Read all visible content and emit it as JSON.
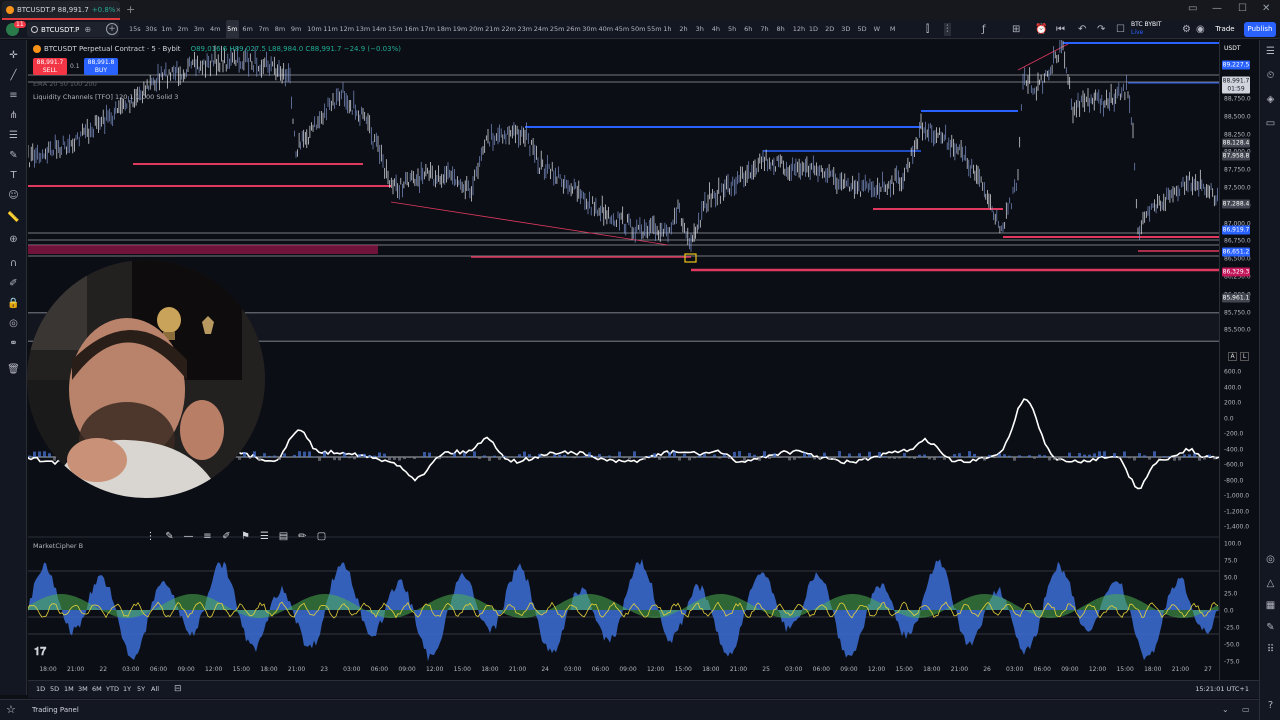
{
  "browser": {
    "tab_title": "BTCUSDT.P",
    "tab_price": "88,991.7",
    "tab_change": "+0.8%"
  },
  "toolbar": {
    "notification_count": "11",
    "symbol": "BTCUSDT.P",
    "intervals": [
      "15s",
      "30s",
      "1m",
      "2m",
      "3m",
      "4m",
      "5m",
      "6m",
      "7m",
      "8m",
      "9m",
      "10m",
      "11m",
      "12m",
      "13m",
      "14m",
      "15m",
      "16m",
      "17m",
      "18m",
      "19m",
      "20m",
      "21m",
      "22m",
      "23m",
      "24m",
      "25m",
      "26m",
      "30m",
      "40m",
      "45m",
      "50m",
      "55m",
      "1h",
      "2h",
      "3h",
      "4h",
      "5h",
      "6h",
      "7h",
      "8h",
      "12h",
      "1D",
      "2D",
      "3D",
      "5D",
      "W",
      "M"
    ],
    "active_interval": "5m",
    "broker": "BTC BYBIT",
    "broker_sub": "Live",
    "trade_label": "Trade",
    "publish_label": "Publish"
  },
  "legend": {
    "title": "BTCUSDT Perpetual Contract · 5 · Bybit",
    "ohlc": "O89,016.6 H89,027.5 L88,984.0 C88,991.7 −24.9 (−0.03%)",
    "sell_price": "88,991.7",
    "sell_label": "SELL",
    "spread": "0.1",
    "buy_price": "88,991.8",
    "buy_label": "BUY",
    "indicator_ema": "EMA 20 50 100 200",
    "indicator_liquidity": "Liquidity Channels [TFO] 120 1 1,000 Solid 3",
    "indicator_bottom": "MarketCipher B"
  },
  "price_axis": {
    "currency": "USDT",
    "labels": [
      "88,750.0",
      "88,500.0",
      "88,250.0",
      "88,000.0",
      "87,750.0",
      "87,500.0",
      "87,250.0",
      "87,000.0",
      "86,750.0",
      "86,500.0",
      "86,250.0",
      "86,000.0",
      "85,750.0",
      "85,500.0"
    ],
    "badges": [
      {
        "text": "89,227.5",
        "color": "blue"
      },
      {
        "text": "88,991.7",
        "color": "white"
      },
      {
        "text": "01:59",
        "color": "white"
      },
      {
        "text": "88,128.4",
        "color": "gray"
      },
      {
        "text": "87,958.8",
        "color": "gray"
      },
      {
        "text": "87,288.4",
        "color": "gray"
      },
      {
        "text": "86,919.7",
        "color": "blue"
      },
      {
        "text": "86,651.2",
        "color": "blue"
      },
      {
        "text": "86,329.3",
        "color": "red"
      },
      {
        "text": "85,961.1",
        "color": "gray"
      }
    ],
    "osc_labels": [
      "600.0",
      "400.0",
      "200.0",
      "0.0",
      "-200.0",
      "-400.0",
      "-600.0",
      "-800.0",
      "-1,000.0",
      "-1,200.0",
      "-1,400.0"
    ],
    "mc_labels": [
      "100.0",
      "75.0",
      "50.0",
      "25.0",
      "0.0",
      "-25.0",
      "-50.0",
      "-75.0"
    ],
    "toggle_auto": "A",
    "toggle_log": "L"
  },
  "time_axis": {
    "labels": [
      "18:00",
      "21:00",
      "22",
      "03:00",
      "06:00",
      "09:00",
      "12:00",
      "15:00",
      "18:00",
      "21:00",
      "23",
      "03:00",
      "06:00",
      "09:00",
      "12:00",
      "15:00",
      "18:00",
      "21:00",
      "24",
      "03:00",
      "06:00",
      "09:00",
      "12:00",
      "15:00",
      "18:00",
      "21:00",
      "25",
      "03:00",
      "06:00",
      "09:00",
      "12:00",
      "15:00",
      "18:00",
      "21:00",
      "26",
      "03:00",
      "06:00",
      "09:00",
      "12:00",
      "15:00",
      "18:00",
      "21:00",
      "27"
    ]
  },
  "range_bar": {
    "ranges": [
      "1D",
      "5D",
      "1M",
      "3M",
      "6M",
      "YTD",
      "1Y",
      "5Y",
      "All"
    ],
    "clock": "15:21:01 UTC+1"
  },
  "trading_panel": {
    "label": "Trading Panel"
  }
}
